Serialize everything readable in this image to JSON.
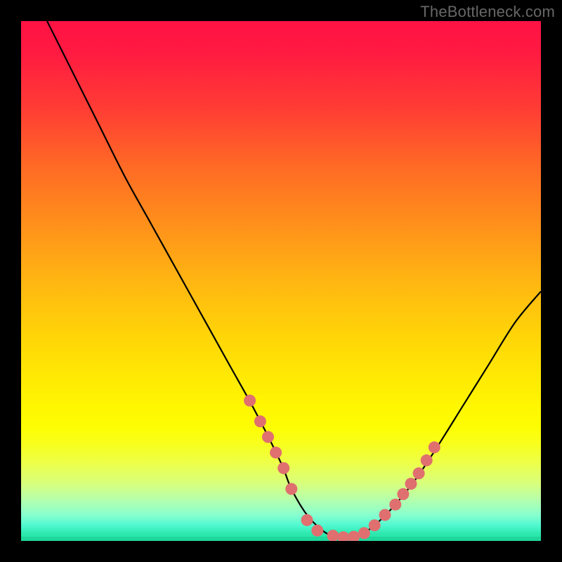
{
  "watermark": "TheBottleneck.com",
  "chart_data": {
    "type": "line",
    "title": "",
    "xlabel": "",
    "ylabel": "",
    "xlim": [
      0,
      100
    ],
    "ylim": [
      0,
      100
    ],
    "series": [
      {
        "name": "main-curve",
        "x": [
          5,
          10,
          15,
          20,
          25,
          30,
          35,
          40,
          45,
          50,
          52,
          55,
          58,
          60,
          63,
          65,
          68,
          72,
          76,
          80,
          85,
          90,
          95,
          100
        ],
        "y": [
          100,
          90,
          80,
          70,
          61,
          52,
          43,
          34,
          25,
          15,
          10,
          5,
          2,
          1,
          0.5,
          1,
          3,
          7,
          12,
          18,
          26,
          34,
          42,
          48
        ]
      }
    ],
    "markers": [
      {
        "x": 44,
        "y": 27
      },
      {
        "x": 46,
        "y": 23
      },
      {
        "x": 47.5,
        "y": 20
      },
      {
        "x": 49,
        "y": 17
      },
      {
        "x": 50.5,
        "y": 14
      },
      {
        "x": 52,
        "y": 10
      },
      {
        "x": 55,
        "y": 4
      },
      {
        "x": 57,
        "y": 2
      },
      {
        "x": 60,
        "y": 1
      },
      {
        "x": 62,
        "y": 0.7
      },
      {
        "x": 64,
        "y": 0.8
      },
      {
        "x": 66,
        "y": 1.5
      },
      {
        "x": 68,
        "y": 3
      },
      {
        "x": 70,
        "y": 5
      },
      {
        "x": 72,
        "y": 7
      },
      {
        "x": 73.5,
        "y": 9
      },
      {
        "x": 75,
        "y": 11
      },
      {
        "x": 76.5,
        "y": 13
      },
      {
        "x": 78,
        "y": 15.5
      },
      {
        "x": 79.5,
        "y": 18
      }
    ],
    "gradient_stops": [
      {
        "pos": 0,
        "color": "#ff1244"
      },
      {
        "pos": 50,
        "color": "#ffb612"
      },
      {
        "pos": 78,
        "color": "#fdfd03"
      },
      {
        "pos": 100,
        "color": "#22e0a0"
      }
    ]
  }
}
